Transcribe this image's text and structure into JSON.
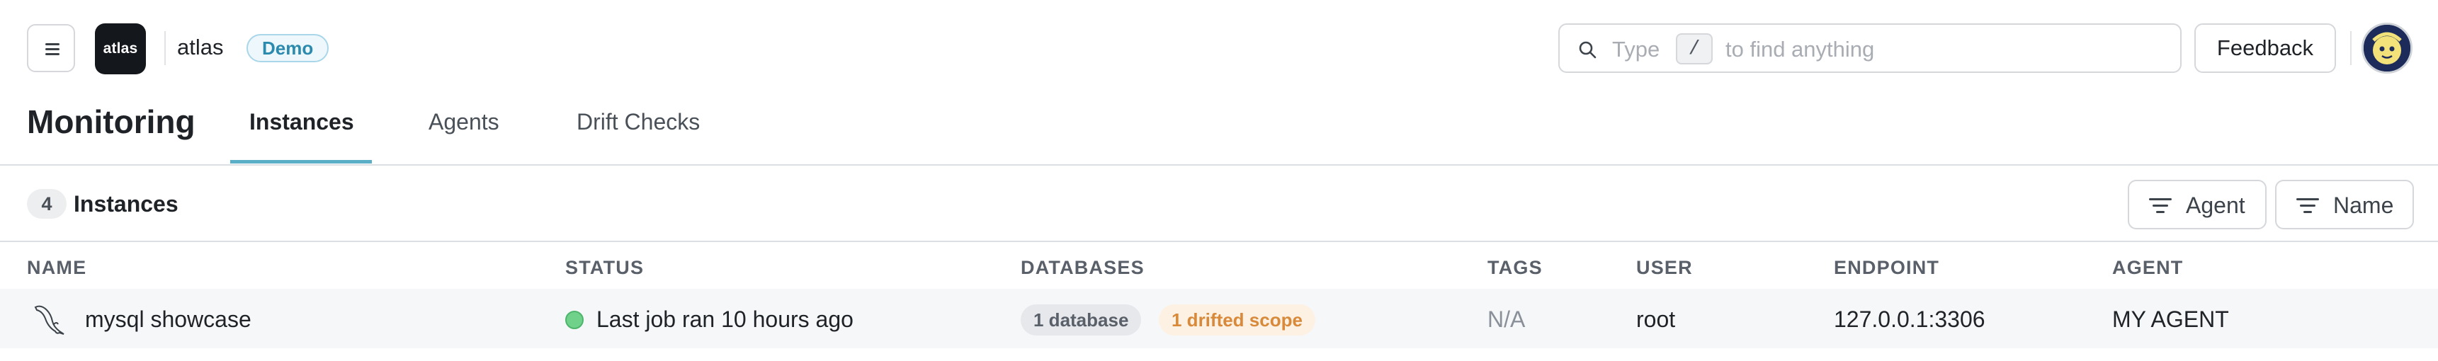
{
  "app": {
    "logo_text": "atlas",
    "name": "atlas",
    "badge": "Demo"
  },
  "search": {
    "prefix": "Type",
    "shortcut": "/",
    "suffix": "to find anything"
  },
  "header": {
    "feedback_label": "Feedback",
    "title": "Monitoring",
    "tabs": [
      {
        "label": "Instances",
        "active": true
      },
      {
        "label": "Agents",
        "active": false
      },
      {
        "label": "Drift Checks",
        "active": false
      }
    ]
  },
  "toolbar": {
    "count": "4",
    "section_title": "Instances",
    "filters": [
      {
        "label": "Agent"
      },
      {
        "label": "Name"
      }
    ]
  },
  "table": {
    "columns": [
      "NAME",
      "STATUS",
      "DATABASES",
      "TAGS",
      "USER",
      "ENDPOINT",
      "AGENT"
    ],
    "rows": [
      {
        "name": "mysql showcase",
        "status": "Last job ran 10 hours ago",
        "status_color": "#6fd18a",
        "databases_badge": "1 database",
        "drift_badge": "1 drifted scope",
        "tags": "N/A",
        "user": "root",
        "endpoint": "127.0.0.1:3306",
        "agent": "MY AGENT"
      }
    ]
  },
  "colors": {
    "accent": "#5aafc7",
    "badge_text": "#2b8aad",
    "drift_text": "#d8893a"
  }
}
